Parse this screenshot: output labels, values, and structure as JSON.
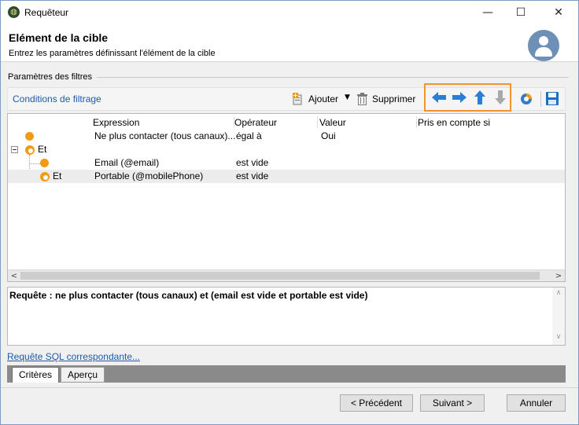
{
  "window": {
    "title": "Requêteur",
    "min_glyph": "—",
    "max_glyph": "☐",
    "close_glyph": "✕"
  },
  "header": {
    "title": "Elément de la cible",
    "subtitle": "Entrez les paramètres définissant l'élément de la cible"
  },
  "filters": {
    "group_label": "Paramètres des filtres",
    "conditions_link": "Conditions de filtrage",
    "add_label": "Ajouter",
    "delete_label": "Supprimer"
  },
  "grid": {
    "columns": [
      "Expression",
      "Opérateur",
      "Valeur",
      "Pris en compte si"
    ],
    "rows": [
      {
        "prefix": "",
        "expression": "Ne plus contacter (tous canaux)...",
        "operator": "égal à",
        "value": "Oui"
      },
      {
        "prefix": "Et",
        "expression": "",
        "operator": "",
        "value": ""
      },
      {
        "prefix": "",
        "expression": "Email (@email)",
        "operator": "est vide",
        "value": ""
      },
      {
        "prefix": "Et",
        "expression": "Portable (@mobilePhone)",
        "operator": "est vide",
        "value": ""
      }
    ]
  },
  "query": {
    "text": "Requête : ne plus contacter (tous canaux) et (email est vide et portable est vide)"
  },
  "sql_link": "Requête SQL correspondante...",
  "tabs": [
    "Critères",
    "Aperçu"
  ],
  "buttons": {
    "previous": "< Précédent",
    "next": "Suivant >",
    "cancel": "Annuler"
  },
  "colors": {
    "accent_orange": "#f0952e",
    "arrow_blue": "#2a7fd4",
    "arrow_disabled": "#a9a9a9",
    "link_blue": "#1e5aa8",
    "node_orange": "#f29a14"
  }
}
